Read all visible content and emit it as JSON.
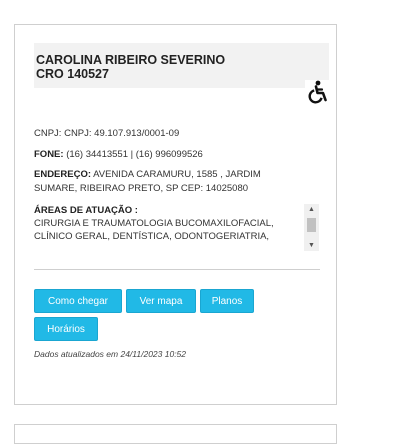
{
  "profile": {
    "name": "CAROLINA RIBEIRO SEVERINO",
    "cro": "CRO 140527"
  },
  "icons": {
    "accessibility": "wheelchair-accessibility-icon"
  },
  "details": {
    "cnpj": "CNPJ: CNPJ: 49.107.913/0001-09",
    "phone_label": "FONE:",
    "phone_value": "(16) 34413551 | (16) 996099526",
    "address_label": "ENDEREÇO:",
    "address_line1": "AVENIDA CARAMURU, 1585 , JARDIM",
    "address_line2": "SUMARE, RIBEIRAO PRETO, SP CEP: 14025080"
  },
  "areas": {
    "title": "ÁREAS DE ATUAÇÃO :",
    "text": "CIRURGIA E TRAUMATOLOGIA BUCOMAXILOFACIAL, CLÍNICO GERAL, DENTÍSTICA, ODONTOGERIATRIA,"
  },
  "buttons": {
    "directions": "Como chegar",
    "map": "Ver mapa",
    "plans": "Planos",
    "hours": "Horários"
  },
  "footer": {
    "updated": "Dados atualizados em 24/11/2023 10:52"
  },
  "colors": {
    "button": "#21b9e6",
    "header_bg": "#f2f2f2"
  }
}
